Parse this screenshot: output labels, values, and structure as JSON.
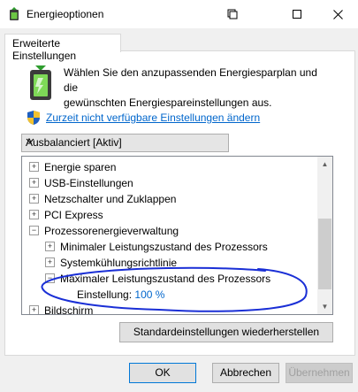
{
  "window": {
    "title": "Energieoptionen",
    "controls": {
      "minimize": "▫",
      "maximize": "□",
      "close": "✕"
    }
  },
  "tab": {
    "label": "Erweiterte Einstellungen"
  },
  "description": {
    "line1": "Wählen Sie den anzupassenden Energiesparplan und die",
    "line2": "gewünschten Energiespareinstellungen aus."
  },
  "link": {
    "label": "Zurzeit nicht verfügbare Einstellungen ändern"
  },
  "plan_select": {
    "value": "Ausbalanciert [Aktiv]"
  },
  "tree": {
    "items": [
      {
        "label": "Energie sparen",
        "expander": "+"
      },
      {
        "label": "USB-Einstellungen",
        "expander": "+"
      },
      {
        "label": "Netzschalter und Zuklappen",
        "expander": "+"
      },
      {
        "label": "PCI Express",
        "expander": "+"
      },
      {
        "label": "Prozessorenergieverwaltung",
        "expander": "−"
      },
      {
        "label": "Minimaler Leistungszustand des Prozessors",
        "expander": "+"
      },
      {
        "label": "Systemkühlungsrichtlinie",
        "expander": "+"
      },
      {
        "label": "Maximaler Leistungszustand des Prozessors",
        "expander": "−"
      },
      {
        "label": "Einstellung:",
        "value": "100 %"
      },
      {
        "label": "Bildschirm",
        "expander": "+"
      }
    ]
  },
  "buttons": {
    "restore": "Standardeinstellungen wiederherstellen",
    "ok": "OK",
    "cancel": "Abbrechen",
    "apply": "Übernehmen"
  },
  "colors": {
    "link": "#0066cc",
    "annotation": "#1a2fd6"
  }
}
